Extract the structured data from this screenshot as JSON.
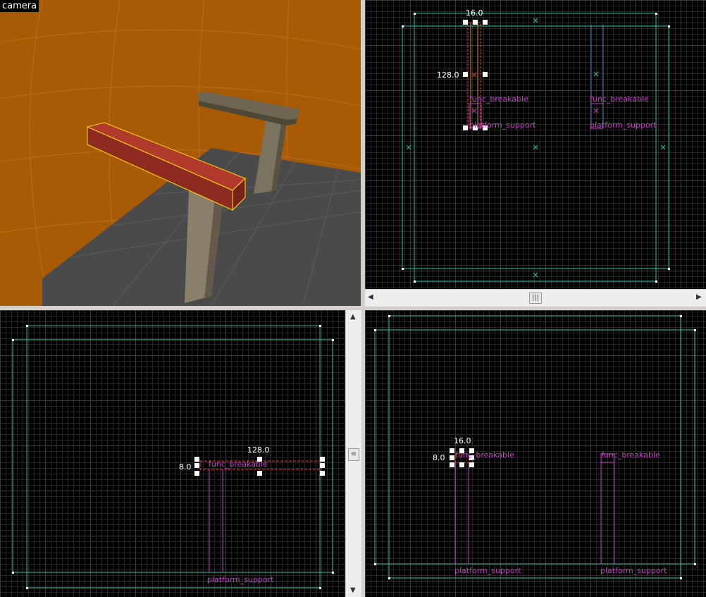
{
  "camera": {
    "label": "camera"
  },
  "top_view": {
    "dim_width": "16.0",
    "dim_length": "128.0",
    "entities": [
      {
        "name": "func_breakable"
      },
      {
        "name": "func_breakable"
      },
      {
        "name": "platform_support"
      },
      {
        "name": "platform_support"
      }
    ]
  },
  "front_view": {
    "dim_width": "128.0",
    "dim_height": "8.0",
    "entities": [
      {
        "name": "func_breakable"
      },
      {
        "name": "platform_support"
      }
    ]
  },
  "side_view": {
    "dim_width": "16.0",
    "dim_height": "8.0",
    "entities": [
      {
        "name": "func_breakable"
      },
      {
        "name": "func_breakable"
      },
      {
        "name": "platform_support"
      },
      {
        "name": "platform_support"
      }
    ]
  },
  "colors": {
    "camera_bg": "#a85a04",
    "grid_minor": "#262626",
    "grid_major": "#3c3c3c",
    "brush_outline": "#30c0a8",
    "entity_magenta": "#c040c0",
    "selection": "#ff3030"
  }
}
